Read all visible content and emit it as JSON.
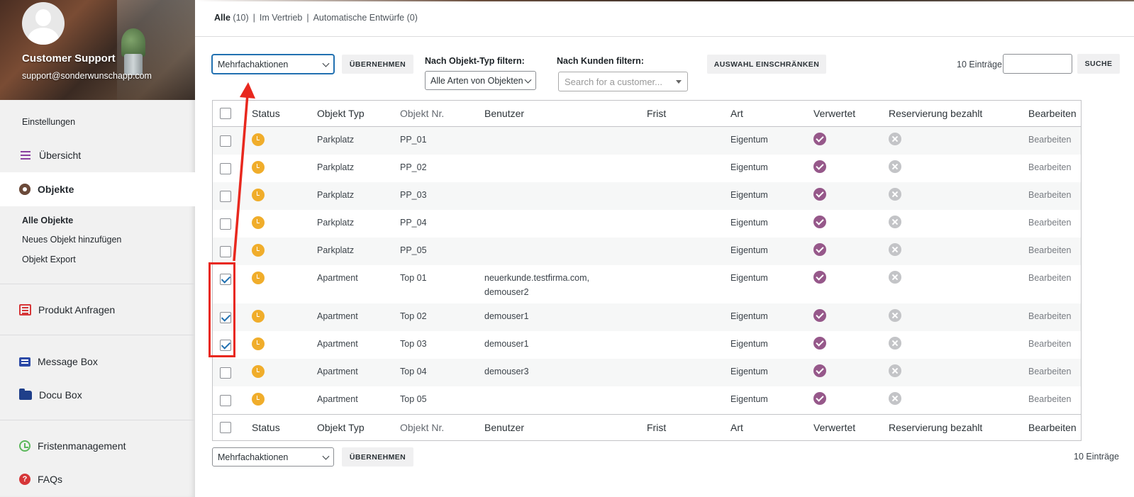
{
  "sidebar": {
    "profile": {
      "name": "Customer Support",
      "email": "support@sonderwunschapp.com"
    },
    "settings_label": "Einstellungen",
    "items": {
      "uebersicht": "Übersicht",
      "objekte": "Objekte",
      "produkt_anfragen": "Produkt Anfragen",
      "message_box": "Message Box",
      "docu_box": "Docu Box",
      "fristenmanagement": "Fristenmanagement",
      "faqs": "FAQs"
    },
    "submenu": {
      "alle_objekte": "Alle Objekte",
      "neues_objekt": "Neues Objekt hinzufügen",
      "objekt_export": "Objekt Export"
    }
  },
  "views": {
    "all": {
      "label": "Alle",
      "count": "(10)"
    },
    "sep1": "|",
    "vertrieb": "Im Vertrieb",
    "sep2": "|",
    "entwuerfe": "Automatische Entwürfe (0)"
  },
  "toolbar": {
    "bulk_actions": "Mehrfachaktionen",
    "apply": "ÜBERNEHMEN",
    "type_filter_label": "Nach Objekt-Typ filtern:",
    "type_filter_value": "Alle Arten von Objekten",
    "customer_filter_label": "Nach Kunden filtern:",
    "customer_placeholder": "Search for a customer...",
    "restrict": "AUSWAHL EINSCHRÄNKEN",
    "entries": "10 Einträge",
    "search": "SUCHE"
  },
  "table": {
    "columns": {
      "status": "Status",
      "typ": "Objekt Typ",
      "nr": "Objekt Nr.",
      "benutzer": "Benutzer",
      "frist": "Frist",
      "art": "Art",
      "verwertet": "Verwertet",
      "reservierung": "Reservierung bezahlt",
      "bearbeiten": "Bearbeiten"
    },
    "rows": [
      {
        "checked": false,
        "typ": "Parkplatz",
        "nr": "PP_01",
        "benutzer": "",
        "benutzer2": "",
        "frist": "",
        "art": "Eigentum",
        "edit": "Bearbeiten"
      },
      {
        "checked": false,
        "typ": "Parkplatz",
        "nr": "PP_02",
        "benutzer": "",
        "benutzer2": "",
        "frist": "",
        "art": "Eigentum",
        "edit": "Bearbeiten"
      },
      {
        "checked": false,
        "typ": "Parkplatz",
        "nr": "PP_03",
        "benutzer": "",
        "benutzer2": "",
        "frist": "",
        "art": "Eigentum",
        "edit": "Bearbeiten"
      },
      {
        "checked": false,
        "typ": "Parkplatz",
        "nr": "PP_04",
        "benutzer": "",
        "benutzer2": "",
        "frist": "",
        "art": "Eigentum",
        "edit": "Bearbeiten"
      },
      {
        "checked": false,
        "typ": "Parkplatz",
        "nr": "PP_05",
        "benutzer": "",
        "benutzer2": "",
        "frist": "",
        "art": "Eigentum",
        "edit": "Bearbeiten"
      },
      {
        "checked": true,
        "typ": "Apartment",
        "nr": "Top 01",
        "benutzer": "neuerkunde.testfirma.com,",
        "benutzer2": "demouser2",
        "frist": "",
        "art": "Eigentum",
        "edit": "Bearbeiten"
      },
      {
        "checked": true,
        "typ": "Apartment",
        "nr": "Top 02",
        "benutzer": "demouser1",
        "benutzer2": "",
        "frist": "",
        "art": "Eigentum",
        "edit": "Bearbeiten"
      },
      {
        "checked": true,
        "typ": "Apartment",
        "nr": "Top 03",
        "benutzer": "demouser1",
        "benutzer2": "",
        "frist": "",
        "art": "Eigentum",
        "edit": "Bearbeiten"
      },
      {
        "checked": false,
        "typ": "Apartment",
        "nr": "Top 04",
        "benutzer": "demouser3",
        "benutzer2": "",
        "frist": "",
        "art": "Eigentum",
        "edit": "Bearbeiten"
      },
      {
        "checked": false,
        "typ": "Apartment",
        "nr": "Top 05",
        "benutzer": "",
        "benutzer2": "",
        "frist": "",
        "art": "Eigentum",
        "edit": "Bearbeiten"
      }
    ]
  },
  "footer": {
    "bulk_actions": "Mehrfachaktionen",
    "apply": "ÜBERNEHMEN",
    "entries": "10 Einträge"
  },
  "colors": {
    "accent": "#2271b1",
    "status_pending": "#f0ad2b",
    "verwertet": "#96588a",
    "reservierung_no": "#c3c4c7",
    "annotation": "#e8281e"
  },
  "icons": {
    "status": "clock-icon",
    "verwertet": "check-circle-icon",
    "reservierung": "x-circle-icon"
  }
}
